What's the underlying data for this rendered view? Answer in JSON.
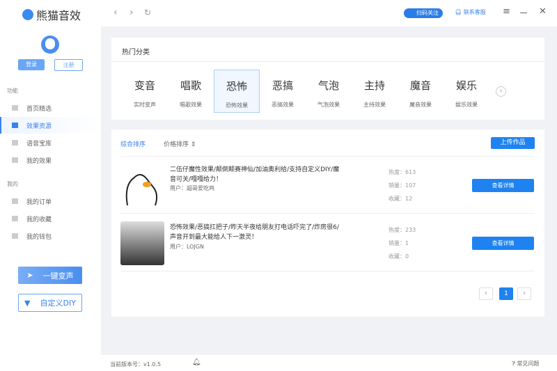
{
  "app": {
    "title": "熊猫音效"
  },
  "header": {
    "scan_label": "扫码关注",
    "service_label": "联系客服"
  },
  "sidebar": {
    "login": "登录",
    "register": "注册",
    "section1": "功能",
    "items1": [
      {
        "label": "首页精选",
        "icon": "monitor-icon"
      },
      {
        "label": "效果资源",
        "icon": "grid-icon",
        "active": true
      },
      {
        "label": "语音宝库",
        "icon": "bar-chart-icon"
      },
      {
        "label": "我的效果",
        "icon": "gear-icon"
      }
    ],
    "section2": "我的",
    "items2": [
      {
        "label": "我的订单",
        "icon": "document-icon"
      },
      {
        "label": "我的收藏",
        "icon": "collection-icon"
      },
      {
        "label": "我的钱包",
        "icon": "wallet-icon"
      }
    ],
    "voice_change": "一键变声",
    "custom_diy": "自定义DIY"
  },
  "categories": {
    "title": "热门分类",
    "items": [
      {
        "name": "变音",
        "sub": "实时变声"
      },
      {
        "name": "唱歌",
        "sub": "唱歌效果"
      },
      {
        "name": "恐怖",
        "sub": "恐怖效果",
        "selected": true
      },
      {
        "name": "恶搞",
        "sub": "恶搞效果"
      },
      {
        "name": "气泡",
        "sub": "气泡效果"
      },
      {
        "name": "主持",
        "sub": "主持效果"
      },
      {
        "name": "魔音",
        "sub": "魔音效果"
      },
      {
        "name": "娱乐",
        "sub": "娱乐效果"
      }
    ]
  },
  "list": {
    "sort_default": "综合排序",
    "sort_price": "价格排序",
    "upload": "上传作品",
    "items": [
      {
        "title": "二伍仔魔性效果/颠倒颠赛神仙/加油奥利给/支持自定义DIY/魔音可关/嘎嘎给力！",
        "user": "用户：超哥爱吃鸡",
        "heat": "热度：613",
        "sales": "销量：107",
        "fav": "收藏：12",
        "button": "查看详情"
      },
      {
        "title": "恐怖效果/恶搞扛把子/昨天半夜给朋友打电话吓完了/炸房很6/声音开到最大能给人下一激灵！",
        "user": "用户：LOJGN",
        "heat": "热度：233",
        "sales": "销量：1",
        "fav": "收藏：0",
        "button": "查看详情"
      }
    ],
    "page": "1"
  },
  "footer": {
    "version": "当前版本号：v1.0.5",
    "faq": "常见问题"
  },
  "colors": {
    "accent": "#1e83f0",
    "background": "#f0f2f5"
  }
}
